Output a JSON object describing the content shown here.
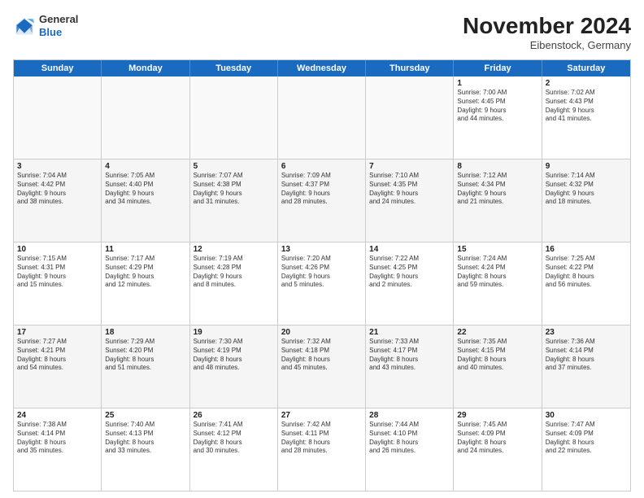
{
  "header": {
    "logo_general": "General",
    "logo_blue": "Blue",
    "month_title": "November 2024",
    "location": "Eibenstock, Germany"
  },
  "days_of_week": [
    "Sunday",
    "Monday",
    "Tuesday",
    "Wednesday",
    "Thursday",
    "Friday",
    "Saturday"
  ],
  "rows": [
    [
      {
        "day": "",
        "info": "",
        "empty": true
      },
      {
        "day": "",
        "info": "",
        "empty": true
      },
      {
        "day": "",
        "info": "",
        "empty": true
      },
      {
        "day": "",
        "info": "",
        "empty": true
      },
      {
        "day": "",
        "info": "",
        "empty": true
      },
      {
        "day": "1",
        "info": "Sunrise: 7:00 AM\nSunset: 4:45 PM\nDaylight: 9 hours\nand 44 minutes.",
        "empty": false
      },
      {
        "day": "2",
        "info": "Sunrise: 7:02 AM\nSunset: 4:43 PM\nDaylight: 9 hours\nand 41 minutes.",
        "empty": false
      }
    ],
    [
      {
        "day": "3",
        "info": "Sunrise: 7:04 AM\nSunset: 4:42 PM\nDaylight: 9 hours\nand 38 minutes.",
        "empty": false
      },
      {
        "day": "4",
        "info": "Sunrise: 7:05 AM\nSunset: 4:40 PM\nDaylight: 9 hours\nand 34 minutes.",
        "empty": false
      },
      {
        "day": "5",
        "info": "Sunrise: 7:07 AM\nSunset: 4:38 PM\nDaylight: 9 hours\nand 31 minutes.",
        "empty": false
      },
      {
        "day": "6",
        "info": "Sunrise: 7:09 AM\nSunset: 4:37 PM\nDaylight: 9 hours\nand 28 minutes.",
        "empty": false
      },
      {
        "day": "7",
        "info": "Sunrise: 7:10 AM\nSunset: 4:35 PM\nDaylight: 9 hours\nand 24 minutes.",
        "empty": false
      },
      {
        "day": "8",
        "info": "Sunrise: 7:12 AM\nSunset: 4:34 PM\nDaylight: 9 hours\nand 21 minutes.",
        "empty": false
      },
      {
        "day": "9",
        "info": "Sunrise: 7:14 AM\nSunset: 4:32 PM\nDaylight: 9 hours\nand 18 minutes.",
        "empty": false
      }
    ],
    [
      {
        "day": "10",
        "info": "Sunrise: 7:15 AM\nSunset: 4:31 PM\nDaylight: 9 hours\nand 15 minutes.",
        "empty": false
      },
      {
        "day": "11",
        "info": "Sunrise: 7:17 AM\nSunset: 4:29 PM\nDaylight: 9 hours\nand 12 minutes.",
        "empty": false
      },
      {
        "day": "12",
        "info": "Sunrise: 7:19 AM\nSunset: 4:28 PM\nDaylight: 9 hours\nand 8 minutes.",
        "empty": false
      },
      {
        "day": "13",
        "info": "Sunrise: 7:20 AM\nSunset: 4:26 PM\nDaylight: 9 hours\nand 5 minutes.",
        "empty": false
      },
      {
        "day": "14",
        "info": "Sunrise: 7:22 AM\nSunset: 4:25 PM\nDaylight: 9 hours\nand 2 minutes.",
        "empty": false
      },
      {
        "day": "15",
        "info": "Sunrise: 7:24 AM\nSunset: 4:24 PM\nDaylight: 8 hours\nand 59 minutes.",
        "empty": false
      },
      {
        "day": "16",
        "info": "Sunrise: 7:25 AM\nSunset: 4:22 PM\nDaylight: 8 hours\nand 56 minutes.",
        "empty": false
      }
    ],
    [
      {
        "day": "17",
        "info": "Sunrise: 7:27 AM\nSunset: 4:21 PM\nDaylight: 8 hours\nand 54 minutes.",
        "empty": false
      },
      {
        "day": "18",
        "info": "Sunrise: 7:29 AM\nSunset: 4:20 PM\nDaylight: 8 hours\nand 51 minutes.",
        "empty": false
      },
      {
        "day": "19",
        "info": "Sunrise: 7:30 AM\nSunset: 4:19 PM\nDaylight: 8 hours\nand 48 minutes.",
        "empty": false
      },
      {
        "day": "20",
        "info": "Sunrise: 7:32 AM\nSunset: 4:18 PM\nDaylight: 8 hours\nand 45 minutes.",
        "empty": false
      },
      {
        "day": "21",
        "info": "Sunrise: 7:33 AM\nSunset: 4:17 PM\nDaylight: 8 hours\nand 43 minutes.",
        "empty": false
      },
      {
        "day": "22",
        "info": "Sunrise: 7:35 AM\nSunset: 4:15 PM\nDaylight: 8 hours\nand 40 minutes.",
        "empty": false
      },
      {
        "day": "23",
        "info": "Sunrise: 7:36 AM\nSunset: 4:14 PM\nDaylight: 8 hours\nand 37 minutes.",
        "empty": false
      }
    ],
    [
      {
        "day": "24",
        "info": "Sunrise: 7:38 AM\nSunset: 4:14 PM\nDaylight: 8 hours\nand 35 minutes.",
        "empty": false
      },
      {
        "day": "25",
        "info": "Sunrise: 7:40 AM\nSunset: 4:13 PM\nDaylight: 8 hours\nand 33 minutes.",
        "empty": false
      },
      {
        "day": "26",
        "info": "Sunrise: 7:41 AM\nSunset: 4:12 PM\nDaylight: 8 hours\nand 30 minutes.",
        "empty": false
      },
      {
        "day": "27",
        "info": "Sunrise: 7:42 AM\nSunset: 4:11 PM\nDaylight: 8 hours\nand 28 minutes.",
        "empty": false
      },
      {
        "day": "28",
        "info": "Sunrise: 7:44 AM\nSunset: 4:10 PM\nDaylight: 8 hours\nand 26 minutes.",
        "empty": false
      },
      {
        "day": "29",
        "info": "Sunrise: 7:45 AM\nSunset: 4:09 PM\nDaylight: 8 hours\nand 24 minutes.",
        "empty": false
      },
      {
        "day": "30",
        "info": "Sunrise: 7:47 AM\nSunset: 4:09 PM\nDaylight: 8 hours\nand 22 minutes.",
        "empty": false
      }
    ]
  ]
}
